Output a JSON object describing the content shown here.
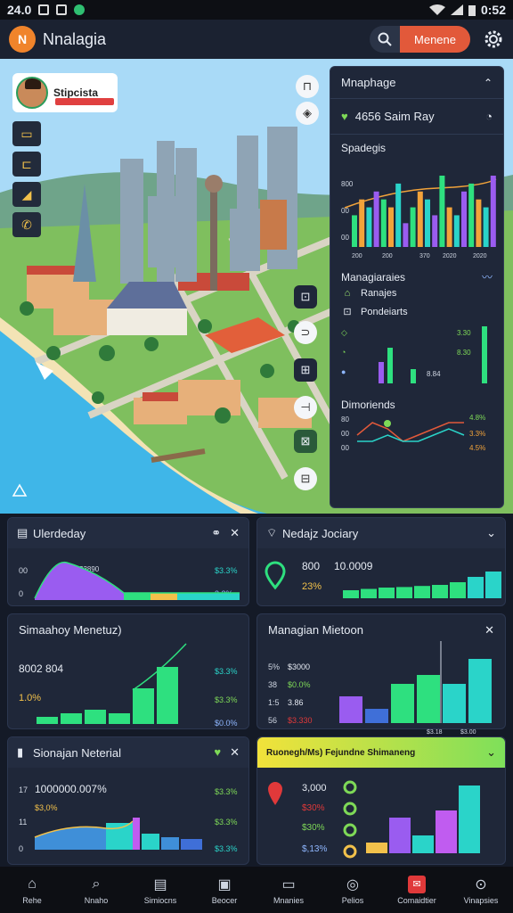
{
  "status": {
    "left_time": "24.0",
    "right_time": "0:52"
  },
  "app": {
    "title": "Nnalagia",
    "logo_text": "N",
    "menu_button": "Menene"
  },
  "map": {
    "profile_name": "Stipcista",
    "left_tools": [
      "▭",
      "⊏",
      "◢",
      "✆"
    ],
    "right_tools": [
      "⊓",
      "◈",
      "⊡",
      "⊃",
      "⊞",
      "⊣",
      "⊠",
      "⊟"
    ]
  },
  "sidepanel": {
    "title": "Mnaphage",
    "row_label": "4656 Saim Ray",
    "section1": "Spadegis",
    "chart1_ticks": {
      "y": [
        "800",
        "00",
        "00"
      ],
      "x": [
        "200",
        "200",
        "370",
        "2020",
        "2020"
      ]
    },
    "section2": "Managiaraies",
    "legend": [
      "Ranajes",
      "Pondeiarts"
    ],
    "chart2_labels": {
      "a": "3.30",
      "b": "8.30",
      "c": "8.84"
    },
    "section3": "Dimoriends",
    "chart3_labels": {
      "y": [
        "80",
        "00",
        "00"
      ],
      "r": [
        "4.8%",
        "3.3%",
        "4.5%"
      ]
    }
  },
  "cards": {
    "c1": {
      "title": "Ulerdeday",
      "peak": "$3890",
      "yl": [
        "00",
        "0"
      ],
      "rl": [
        "$3.3%",
        "3.3%"
      ]
    },
    "c2": {
      "title": "Nedajz Jociary",
      "v1": "800",
      "v2": "10.0009",
      "v3": "23%"
    },
    "c3": {
      "title": "Simaahoy Menetuz)",
      "v1": "8002 804",
      "v2": "1.0%",
      "rl": [
        "$3.3%",
        "$3.3%",
        "$0.0%"
      ]
    },
    "c4": {
      "title": "Managian Mietoon",
      "yl": [
        "5%",
        "38",
        "1:5",
        "56"
      ],
      "vl": [
        "$3000",
        "$0.0%",
        "3.86",
        "$3.330"
      ],
      "xl": [
        "$3.18",
        "$3.00"
      ]
    },
    "c5": {
      "title": "Sionajan Neterial",
      "v1": "1000000.007%",
      "v2": "$3,0%",
      "yl": [
        "17",
        "11",
        "0"
      ],
      "rl": [
        "$3.3%",
        "$3.3%",
        "$3.3%"
      ]
    },
    "c6": {
      "title": "Ruonegh/Ms) Fejundne Shimaneng",
      "vl": [
        "3,000",
        "$30%",
        "$30%",
        "$,13%"
      ]
    }
  },
  "nav": [
    "Rehe",
    "Nnaho",
    "Simiocns",
    "Beocer",
    "Mnanies",
    "Pelios",
    "Comaidtier",
    "Vinapsies"
  ],
  "colors": {
    "accent": "#e2593a",
    "green": "#2ee07f",
    "teal": "#2ad4c9",
    "purple": "#9a5cf0",
    "yellow": "#f2c14b"
  },
  "chart_data": [
    {
      "type": "bar",
      "title": "Spadegis",
      "values": [
        4,
        6,
        5,
        7,
        6,
        5,
        8,
        3,
        5,
        7,
        6,
        4,
        9,
        5,
        4,
        7,
        8,
        6,
        5,
        9
      ]
    },
    {
      "type": "bar",
      "title": "Managiaraies",
      "values": [
        3,
        5,
        2,
        8
      ]
    },
    {
      "type": "line",
      "title": "Dimoriends",
      "series": [
        {
          "values": [
            3,
            5,
            4,
            2,
            3,
            4,
            5,
            5
          ]
        },
        {
          "values": [
            2,
            2,
            3,
            2,
            2,
            3,
            4,
            3
          ]
        }
      ]
    }
  ]
}
